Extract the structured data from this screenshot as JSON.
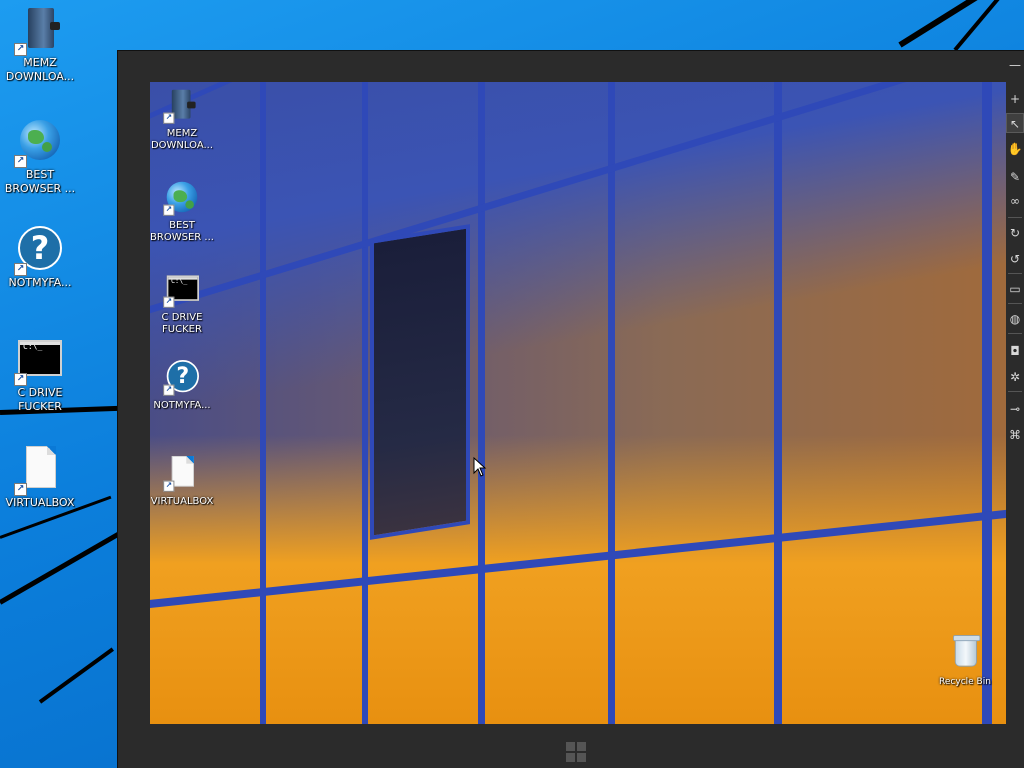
{
  "host_desktop": {
    "icons": [
      {
        "label": "MEMZ DOWNLOA...",
        "icon": "book-icon"
      },
      {
        "label": "BEST BROWSER ...",
        "icon": "globe-icon"
      },
      {
        "label": "NOTMYFA...",
        "icon": "question-icon"
      },
      {
        "label": "C DRIVE FUCKER",
        "icon": "console-icon"
      },
      {
        "label": "VIRTUALBOX",
        "icon": "document-icon"
      }
    ]
  },
  "vm_window": {
    "guest_icons": [
      {
        "label": "MEMZ DOWNLOA...",
        "icon": "book-icon"
      },
      {
        "label": "BEST BROWSER ...",
        "icon": "globe-icon"
      },
      {
        "label": "C DRIVE FUCKER",
        "icon": "console-icon"
      },
      {
        "label": "NOTMYFA...",
        "icon": "question-icon"
      },
      {
        "label": "VIRTUALBOX",
        "icon": "document-icon"
      }
    ],
    "recycle_bin": {
      "label": "Recycle Bin",
      "icon": "recycle-bin-icon"
    },
    "toolbar": [
      {
        "icon": "minimize-icon",
        "glyph": "—"
      },
      {
        "icon": "pin-icon",
        "glyph": "+"
      },
      {
        "icon": "pointer-tool-icon",
        "glyph": "↖"
      },
      {
        "icon": "hand-tool-icon",
        "glyph": "✋"
      },
      {
        "icon": "brush-tool-icon",
        "glyph": "✎"
      },
      {
        "icon": "link-tool-icon",
        "glyph": "∞"
      },
      {
        "icon": "refresh-icon",
        "glyph": "↻"
      },
      {
        "icon": "restore-icon",
        "glyph": "↺"
      },
      {
        "icon": "monitor-icon",
        "glyph": "▭"
      },
      {
        "icon": "globe-icon",
        "glyph": "◍"
      },
      {
        "icon": "camera-icon",
        "glyph": "◘"
      },
      {
        "icon": "settings-gear-icon",
        "glyph": "✲"
      },
      {
        "icon": "usb-icon",
        "glyph": "⊸"
      },
      {
        "icon": "network-icon",
        "glyph": "⌘"
      }
    ]
  },
  "colors": {
    "host_accent": "#0a79d6",
    "vm_frame": "#2b2b2b",
    "facade_blue": "#2f49b8",
    "facade_orange": "#f0a020"
  }
}
